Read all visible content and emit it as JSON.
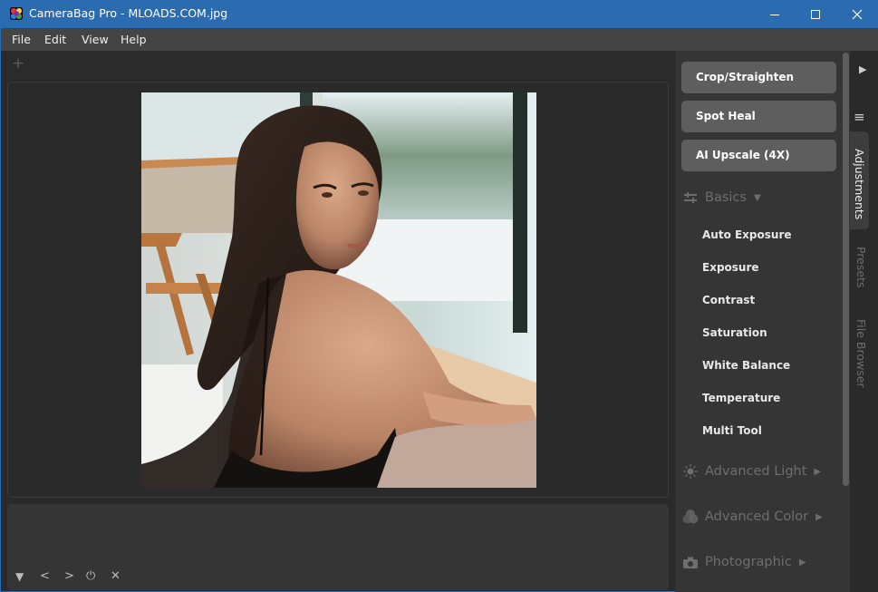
{
  "window": {
    "title": "CameraBag Pro - MLOADS.COM.jpg",
    "controls": {
      "minimize": "minimize",
      "maximize": "maximize",
      "close": "close"
    },
    "accent_color": "#2b6cb0"
  },
  "menubar": {
    "items": [
      "File",
      "Edit",
      "View",
      "Help"
    ]
  },
  "canvas": {
    "add_tab_icon": "+",
    "image_description": "Portrait photo of a woman with long dark hair in a black dress, looking over her shoulder, seated by a window"
  },
  "filmstrip": {
    "controls": [
      {
        "name": "collapse",
        "glyph": "▼"
      },
      {
        "name": "previous",
        "glyph": "<"
      },
      {
        "name": "next",
        "glyph": ">"
      },
      {
        "name": "power",
        "glyph": "⏻"
      },
      {
        "name": "close",
        "glyph": "✕"
      }
    ]
  },
  "right_panel": {
    "tool_buttons": [
      "Crop/Straighten",
      "Spot Heal",
      "AI Upscale (4X)"
    ],
    "sections": [
      {
        "label": "Basics",
        "icon": "sliders-icon",
        "expanded": true,
        "items": [
          "Auto Exposure",
          "Exposure",
          "Contrast",
          "Saturation",
          "White Balance",
          "Temperature",
          "Multi Tool"
        ]
      },
      {
        "label": "Advanced Light",
        "icon": "sun-icon",
        "expanded": false
      },
      {
        "label": "Advanced Color",
        "icon": "color-circles-icon",
        "expanded": false
      },
      {
        "label": "Photographic",
        "icon": "camera-icon",
        "expanded": false
      }
    ]
  },
  "side_tabs": {
    "collapse_glyph": "▶",
    "menu_glyph": "≡",
    "tabs": [
      {
        "label": "Adjustments",
        "active": true
      },
      {
        "label": "Presets",
        "active": false
      },
      {
        "label": "File Browser",
        "active": false
      }
    ]
  }
}
